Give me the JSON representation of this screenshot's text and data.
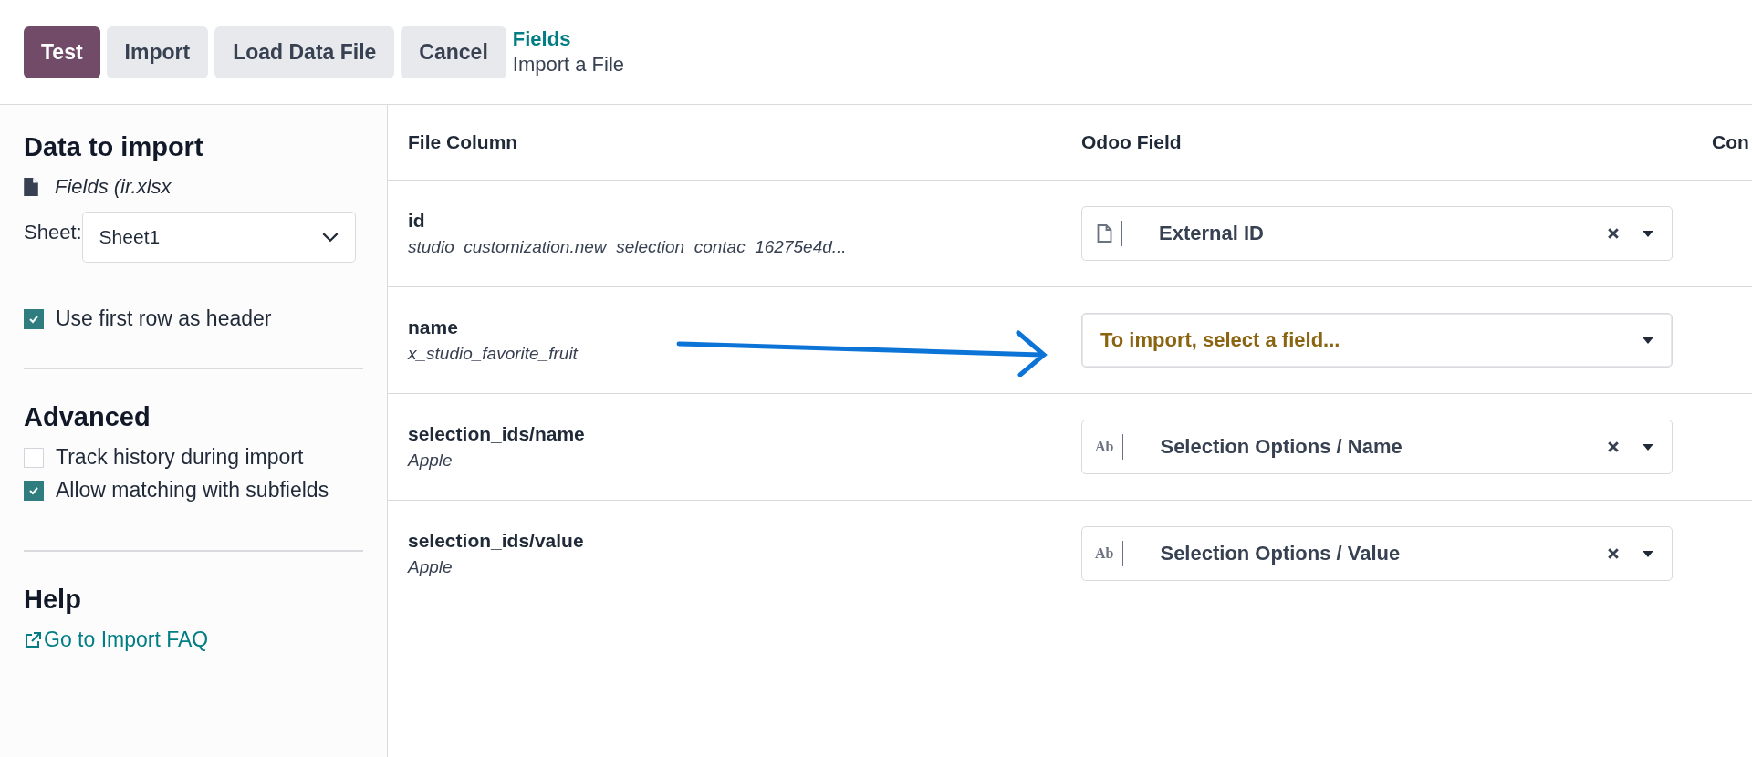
{
  "toolbar": {
    "buttons": [
      {
        "label": "Test",
        "kind": "primary"
      },
      {
        "label": "Import",
        "kind": "secondary"
      },
      {
        "label": "Load Data File",
        "kind": "secondary"
      },
      {
        "label": "Cancel",
        "kind": "secondary"
      }
    ],
    "breadcrumb": {
      "parent": "Fields",
      "current": "Import a File"
    }
  },
  "sidebar": {
    "data_title": "Data to import",
    "file_name": "Fields (ir.xlsx",
    "sheet_label": "Sheet:",
    "sheet_value": "Sheet1",
    "header_option": {
      "label": "Use first row as header",
      "checked": true
    },
    "advanced_title": "Advanced",
    "advanced_options": [
      {
        "label": "Track history during import",
        "checked": false
      },
      {
        "label": "Allow matching with subfields",
        "checked": true
      }
    ],
    "help_title": "Help",
    "help_link": "Go to Import FAQ"
  },
  "table": {
    "columns": [
      "File Column",
      "Odoo Field",
      "Con"
    ],
    "rows": [
      {
        "name": "id",
        "sample": "studio_customization.new_selection_contac_16275e4d...",
        "field": {
          "kind": "file",
          "label": "External ID"
        }
      },
      {
        "name": "name",
        "sample": "x_studio_favorite_fruit",
        "field": {
          "kind": "empty",
          "placeholder": "To import, select a field..."
        }
      },
      {
        "name": "selection_ids/name",
        "sample": "Apple",
        "field": {
          "kind": "text",
          "icon_text": "Ab",
          "label": "Selection Options / Name"
        }
      },
      {
        "name": "selection_ids/value",
        "sample": "Apple",
        "field": {
          "kind": "text",
          "icon_text": "Ab",
          "label": "Selection Options / Value"
        }
      }
    ]
  }
}
